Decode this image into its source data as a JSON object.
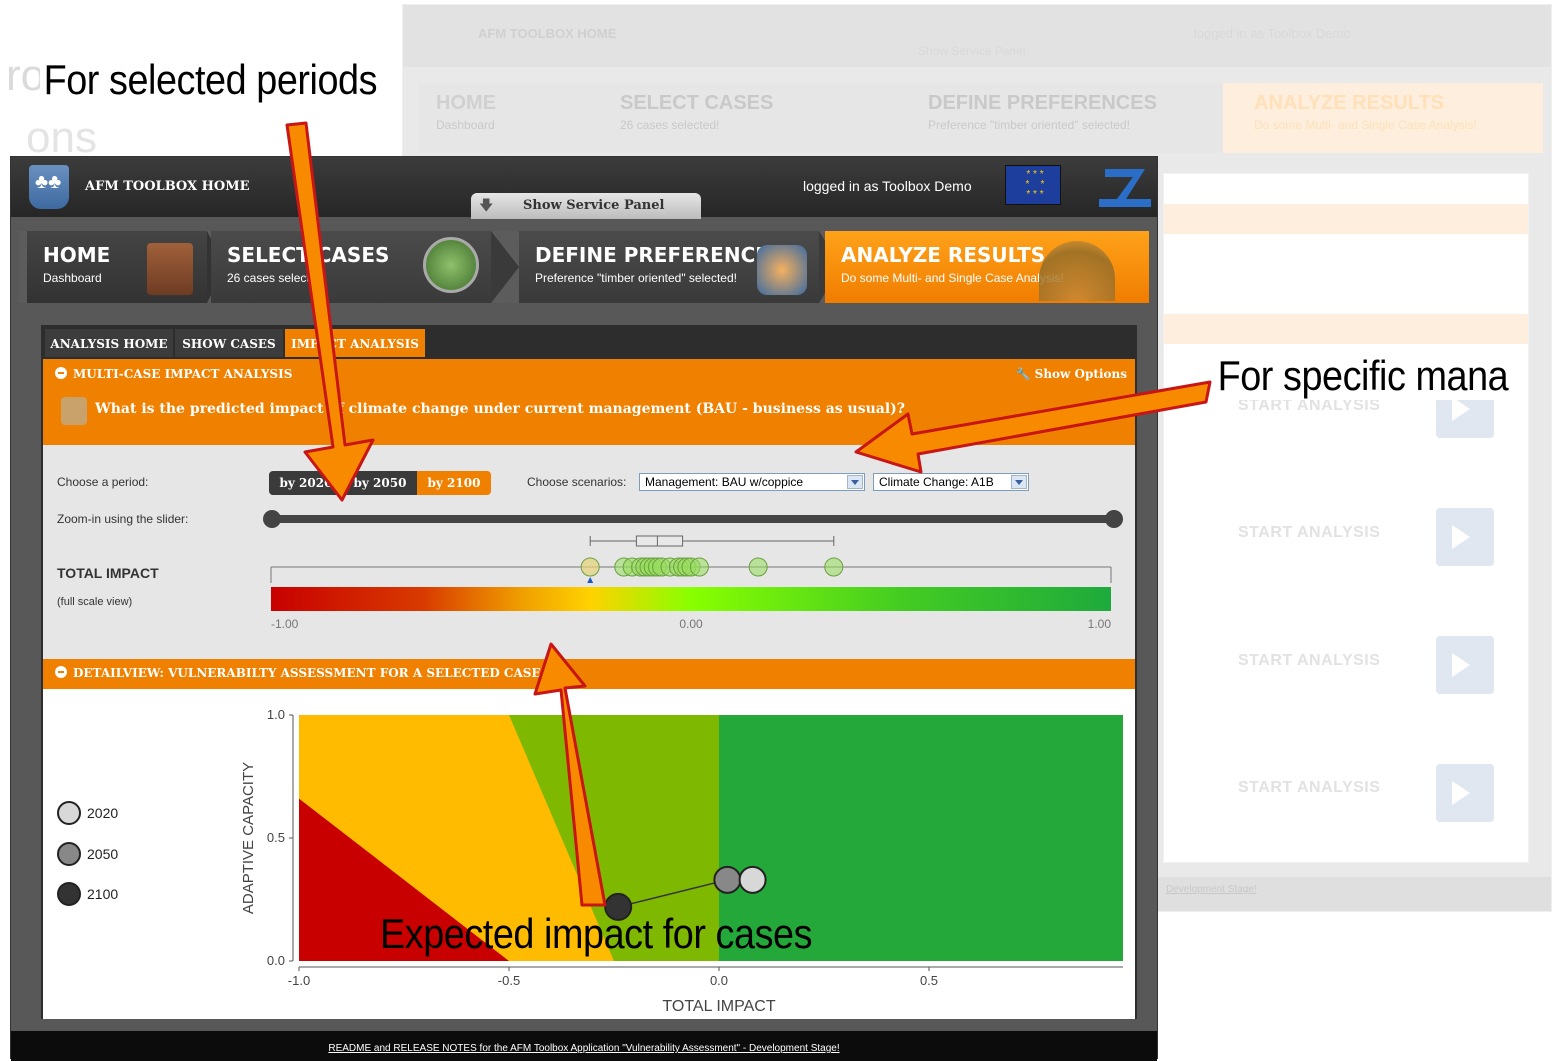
{
  "annotations": {
    "periods": "For selected periods",
    "management": "For specific mana",
    "expected": "Expected impact for cases"
  },
  "background_slide": {
    "ghost_words": [
      "ron key",
      "ons"
    ]
  },
  "background_window": {
    "title": "AFM TOOLBOX HOME",
    "logged": "logged in as Toolbox Demo",
    "service": "Show Service Panel",
    "steps": [
      {
        "title": "HOME",
        "sub": "Dashboard"
      },
      {
        "title": "SELECT CASES",
        "sub": "26 cases selected!"
      },
      {
        "title": "DEFINE PREFERENCES",
        "sub": "Preference \"timber oriented\" selected!"
      },
      {
        "title": "ANALYZE RESULTS",
        "sub": "Do some Multi- and Single Case Analysis!"
      }
    ],
    "start_label": "START ANALYSIS",
    "footer": "Development Stage!"
  },
  "app": {
    "title": "AFM TOOLBOX HOME",
    "logged": "logged in as Toolbox Demo",
    "service_panel": "Show Service Panel"
  },
  "steps": [
    {
      "title": "HOME",
      "sub": "Dashboard"
    },
    {
      "title": "SELECT CASES",
      "sub": "26 cases selected!"
    },
    {
      "title": "DEFINE PREFERENCES",
      "sub": "Preference \"timber oriented\" selected!"
    },
    {
      "title": "ANALYZE RESULTS",
      "sub": "Do some Multi- and Single Case Analysis!"
    }
  ],
  "tabs": [
    "ANALYSIS HOME",
    "SHOW CASES",
    "IMPACT ANALYSIS"
  ],
  "multicase": {
    "header": "MULTI-CASE IMPACT ANALYSIS",
    "show_options": "Show Options",
    "question": "What is the predicted impact of climate change under current management (BAU - business as usual)?",
    "period_label": "Choose a period:",
    "periods": [
      "by 2020",
      "by 2050",
      "by 2100"
    ],
    "selected_period": "by 2100",
    "scenario_label": "Choose scenarios:",
    "management_value": "Management: BAU w/coppice",
    "climate_value": "Climate Change: A1B",
    "zoom_label": "Zoom-in using the slider:",
    "total_impact": "TOTAL IMPACT",
    "full_scale": "(full scale view)",
    "scale_ticks": [
      "-1.00",
      "0.00",
      "1.00"
    ]
  },
  "detail": {
    "header": "DETAILVIEW: VULNERABILTY ASSESSMENT FOR A SELECTED CASE",
    "legend": [
      "2020",
      "2050",
      "2100"
    ],
    "legend_colors": [
      "#d8d8d8",
      "#888888",
      "#333333"
    ]
  },
  "footer": "README and RELEASE NOTES for the AFM Toolbox Application \"Vulnerability Assessment\" - Development Stage!",
  "chart_data": [
    {
      "type": "scatter",
      "title": "TOTAL IMPACT",
      "xlim": [
        -1,
        1
      ],
      "x_ticks": [
        "-1.00",
        "0.00",
        "1.00"
      ],
      "points": [
        -0.24,
        -0.16,
        -0.14,
        -0.12,
        -0.11,
        -0.1,
        -0.09,
        -0.08,
        -0.07,
        -0.05,
        -0.03,
        -0.02,
        -0.01,
        0.0,
        0.02,
        0.16,
        0.34
      ],
      "boxplot": {
        "whisker_low": -0.24,
        "q1": -0.13,
        "median": -0.08,
        "q3": -0.02,
        "whisker_high": 0.34
      },
      "marker": -0.24
    },
    {
      "type": "scatter",
      "xlabel": "TOTAL IMPACT",
      "ylabel": "ADAPTIVE CAPACITY",
      "xlim": [
        -1,
        1
      ],
      "ylim": [
        0,
        1
      ],
      "x_ticks": [
        "-1.0",
        "-0.5",
        "0.0",
        "0.5",
        "1.0"
      ],
      "y_ticks": [
        "0.0",
        "0.5",
        "1.0"
      ],
      "series": [
        {
          "name": "2020",
          "x": [
            0.08
          ],
          "y": [
            0.33
          ]
        },
        {
          "name": "2050",
          "x": [
            0.02
          ],
          "y": [
            0.33
          ]
        },
        {
          "name": "2100",
          "x": [
            -0.24
          ],
          "y": [
            0.22
          ]
        }
      ]
    }
  ]
}
